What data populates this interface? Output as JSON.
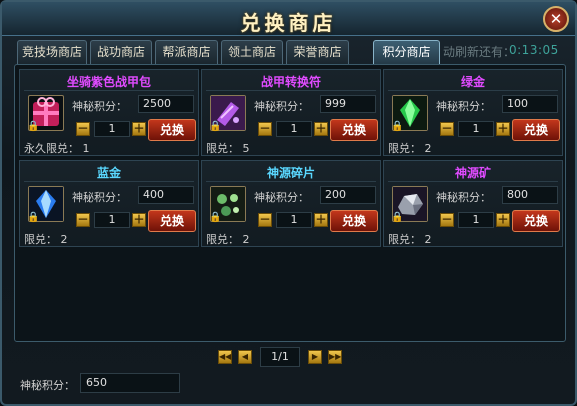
{
  "window": {
    "title": "兑换商店",
    "close": "✕"
  },
  "tabs": [
    {
      "label": "竞技场商店"
    },
    {
      "label": "战功商店"
    },
    {
      "label": "帮派商店"
    },
    {
      "label": "领土商店"
    },
    {
      "label": "荣誉商店"
    },
    {
      "label": "积分商店",
      "active": true
    }
  ],
  "refresh": {
    "text": "动刷新还有：",
    "time": "0:13:05"
  },
  "common": {
    "points_label": "神秘积分：",
    "exchange_label": "兑换",
    "minus": "－",
    "plus": "＋"
  },
  "items": [
    {
      "name": "坐骑紫色战甲包",
      "name_color": "purple",
      "cost": "2500",
      "qty": "1",
      "limit": "永久限兑：  1",
      "icon": "purple-gift-pack-icon",
      "locked": true
    },
    {
      "name": "战甲转换符",
      "name_color": "purple",
      "cost": "999",
      "qty": "1",
      "limit": "限兑：  5",
      "icon": "purple-scroll-icon",
      "locked": true
    },
    {
      "name": "绿金",
      "name_color": "purple",
      "cost": "100",
      "qty": "1",
      "limit": "限兑：  2",
      "icon": "green-gem-icon",
      "locked": true
    },
    {
      "name": "蓝金",
      "name_color": "blue",
      "cost": "400",
      "qty": "1",
      "limit": "限兑：  2",
      "icon": "blue-gem-icon",
      "locked": true
    },
    {
      "name": "神源碎片",
      "name_color": "blue",
      "cost": "200",
      "qty": "1",
      "limit": "限兑：  2",
      "icon": "shards-icon",
      "locked": true
    },
    {
      "name": "神源矿",
      "name_color": "purple",
      "cost": "800",
      "qty": "1",
      "limit": "限兑：  2",
      "icon": "ore-icon",
      "locked": true
    }
  ],
  "pager": {
    "page": "1/1",
    "first": "◀◀",
    "prev": "◀",
    "next": "▶",
    "last": "▶▶"
  },
  "footer": {
    "label": "神秘积分：",
    "value": "650"
  }
}
